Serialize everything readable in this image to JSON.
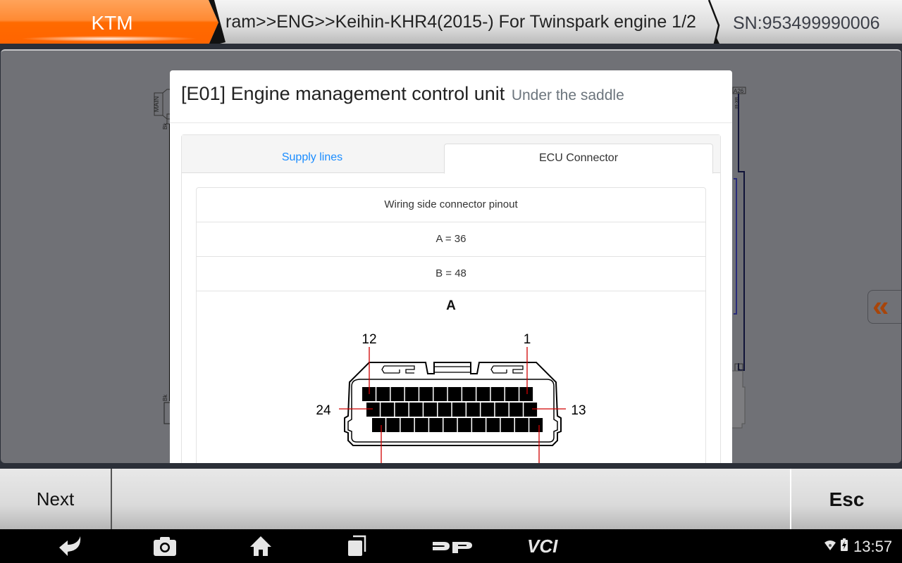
{
  "header": {
    "brand": "KTM",
    "breadcrumb": "ram>>ENG>>Keihin-KHR4(2015-) For Twinspark engine 1/2",
    "serial": "SN:953499990006",
    "brand_color": "#ff6a00"
  },
  "background_diagram": {
    "labels": [
      "MAIN",
      "Bk",
      "Bk",
      "A26",
      "Bk-Bl",
      "Bk-Bl",
      "1"
    ]
  },
  "side_toggle": {
    "icon": "double-chevron-left-icon",
    "glyph": "«"
  },
  "modal": {
    "title": "[E01] Engine management control unit",
    "subtitle": "Under the saddle",
    "tabs": [
      {
        "label": "Supply lines",
        "active": false
      },
      {
        "label": "ECU Connector",
        "active": true
      }
    ],
    "pinout": {
      "rows": [
        "Wiring side connector pinout",
        "A = 36",
        "B = 48"
      ],
      "connector": {
        "name": "A",
        "rows": 3,
        "pins_per_row": 12,
        "callouts": [
          "12",
          "1",
          "24",
          "13"
        ]
      }
    }
  },
  "footer": {
    "next_label": "Next",
    "esc_label": "Esc"
  },
  "navbar": {
    "icons": [
      "back-icon",
      "screenshot-camera-icon",
      "home-icon",
      "recent-apps-icon",
      "dp-logo-icon",
      "vci-icon"
    ],
    "dp_text": "DP",
    "vci_text": "VCI",
    "time": "13:57"
  }
}
